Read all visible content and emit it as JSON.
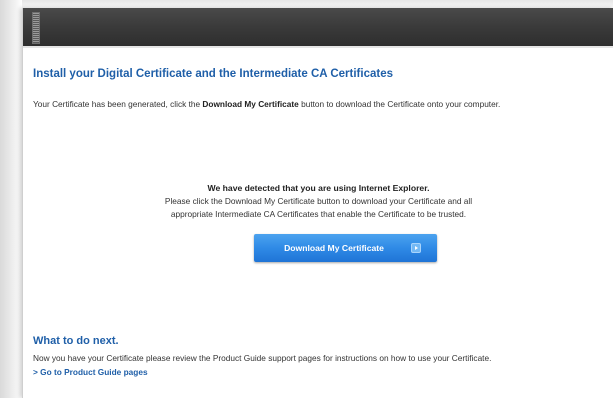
{
  "header": {
    "grip_icon": "drag-grip-icon"
  },
  "main": {
    "title": "Install your Digital Certificate and the Intermediate CA Certificates",
    "intro": {
      "before": "Your Certificate has been generated, click the ",
      "bold": "Download My Certificate",
      "after": " button to download the Certificate onto your computer."
    },
    "detect_heading": "We have detected that you are using Internet Explorer.",
    "detect_line1": "Please click the Download My Certificate button to download your Certificate and all",
    "detect_line2": "appropriate Intermediate CA Certificates that enable the Certificate to be trusted.",
    "download_button": {
      "label": "Download My Certificate",
      "icon": "arrow-right-icon",
      "color": "#2f8ae6"
    }
  },
  "next": {
    "title": "What to do next.",
    "text": "Now you have your Certificate please review the Product Guide support pages for instructions on how to use your Certificate.",
    "link": "> Go to Product Guide pages"
  },
  "colors": {
    "heading_blue": "#1f5fa8",
    "header_dark": "#3a3a3a",
    "body_text": "#333333"
  }
}
